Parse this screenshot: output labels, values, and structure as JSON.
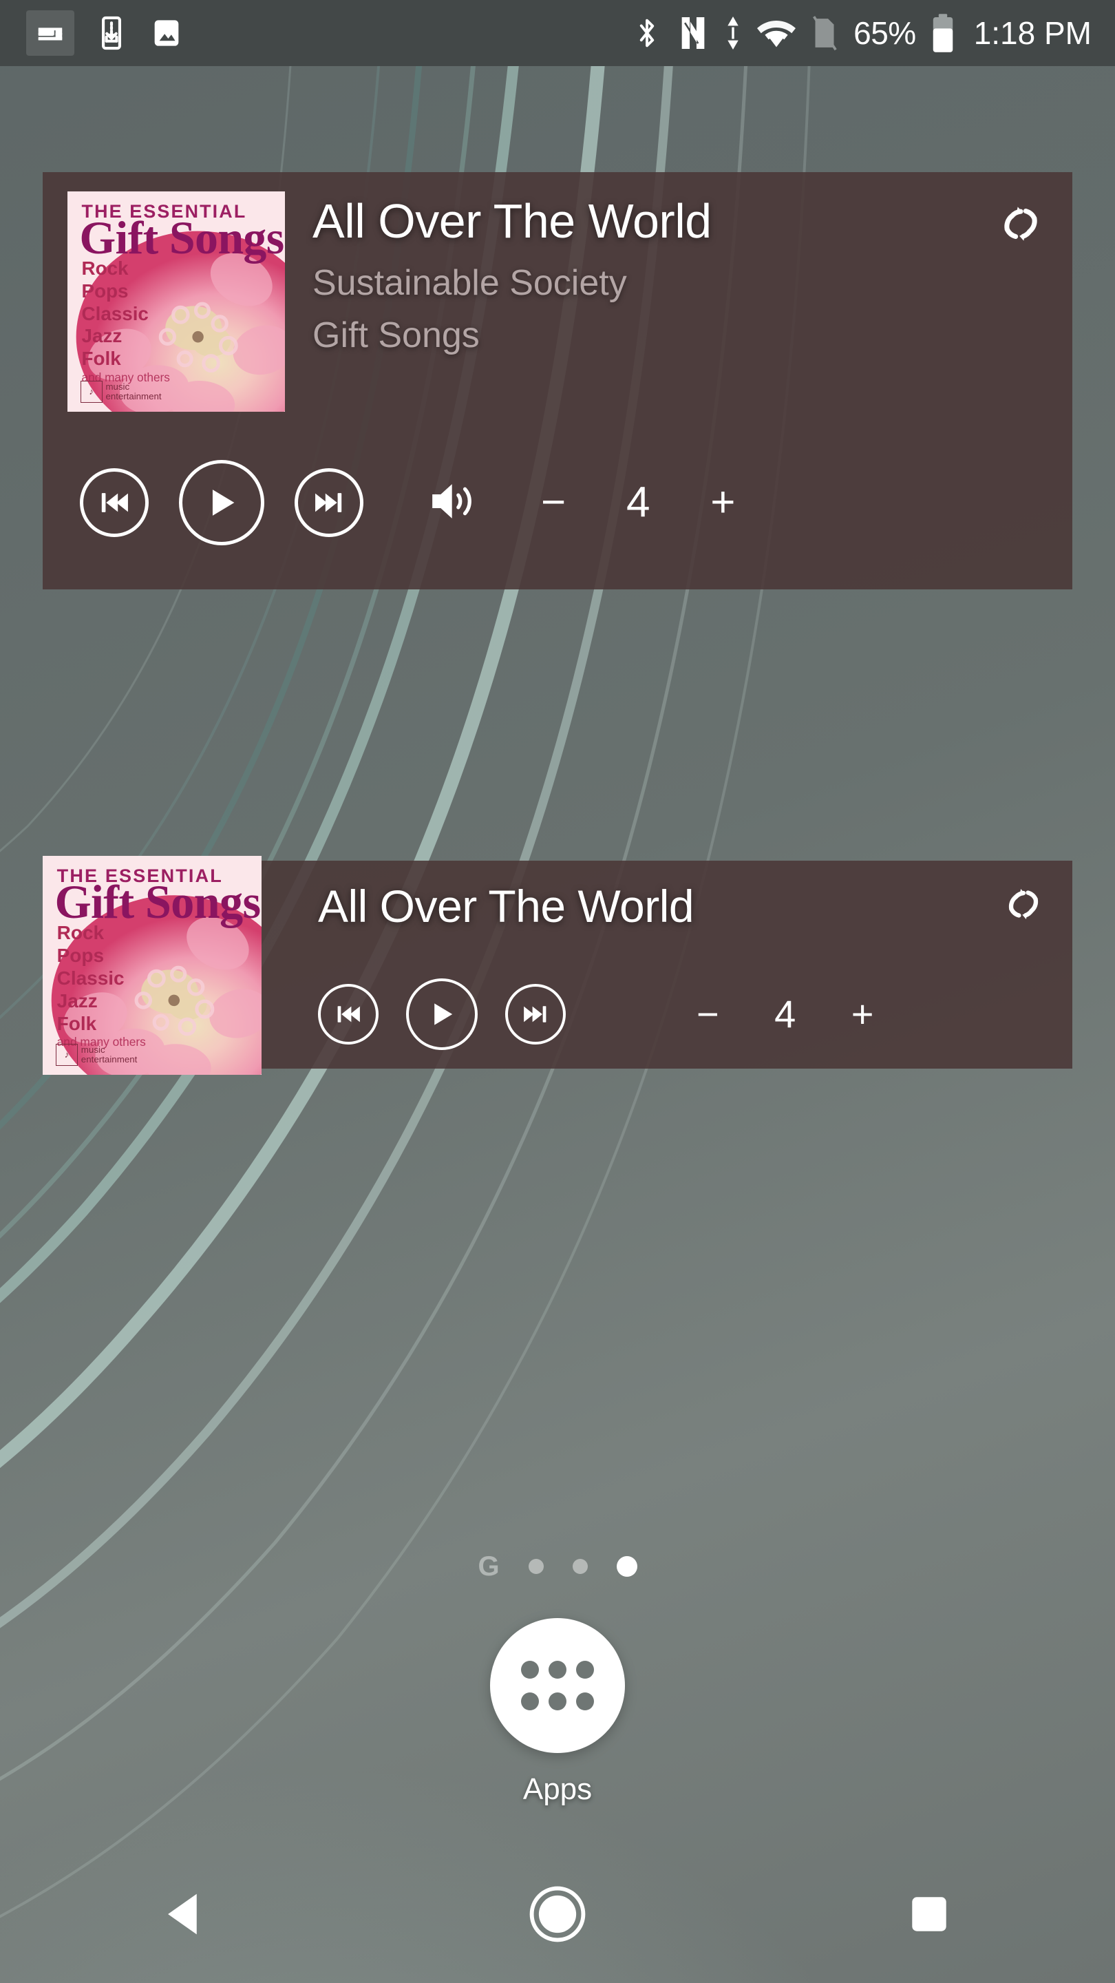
{
  "status_bar": {
    "left_icons": [
      {
        "name": "cast-media-icon",
        "highlighted": true
      },
      {
        "name": "download-to-device-icon",
        "highlighted": false
      },
      {
        "name": "screenshot-image-icon",
        "highlighted": false
      }
    ],
    "right_icons": [
      {
        "name": "bluetooth-icon"
      },
      {
        "name": "nfc-icon"
      },
      {
        "name": "data-transfer-icon"
      },
      {
        "name": "wifi-icon"
      },
      {
        "name": "no-sim-icon"
      }
    ],
    "battery_percent": "65%",
    "battery_icon": "battery-icon",
    "clock": "1:18 PM"
  },
  "album_art": {
    "top_line": "THE ESSENTIAL",
    "brand": "Gift Songs",
    "genres": [
      "Rock",
      "Pops",
      "Classic",
      "Jazz",
      "Folk"
    ],
    "more_text": "and many others",
    "logo_line1": "music",
    "logo_line2": "entertainment"
  },
  "widget_large": {
    "name": "music-player-widget-large",
    "title": "All Over The World",
    "artist": "Sustainable Society",
    "album": "Gift Songs",
    "repeat_icon": "repeat-icon",
    "previous_label": "previous-track",
    "play_label": "play",
    "next_label": "next-track",
    "volume_icon": "volume-speaker-icon",
    "volume_down_label": "−",
    "volume_value": "4",
    "volume_up_label": "+",
    "background_color": "#4a3737"
  },
  "widget_compact": {
    "name": "music-player-widget-compact",
    "title": "All Over The World",
    "repeat_icon": "repeat-icon",
    "previous_label": "previous-track",
    "play_label": "play",
    "next_label": "next-track",
    "volume_down_label": "−",
    "volume_value": "4",
    "volume_up_label": "+",
    "background_color": "#4a3737"
  },
  "home_screen": {
    "google_indicator": "G",
    "page_dots": [
      {
        "active": false
      },
      {
        "active": false
      },
      {
        "active": true
      }
    ],
    "apps_label": "Apps",
    "apps_icon": "apps-grid-icon"
  },
  "nav_bar": {
    "back_icon": "back-triangle-icon",
    "home_icon": "home-circle-icon",
    "recents_icon": "recents-square-icon"
  },
  "colors": {
    "wallpaper_base": "#616b6b",
    "status_bar": "#434848",
    "widget_bg": "#4a3737",
    "accent_text": "#ffffff",
    "secondary_text": "#b3a5a5",
    "album_pink": "#ef88a6",
    "album_magenta": "#8a1560"
  }
}
